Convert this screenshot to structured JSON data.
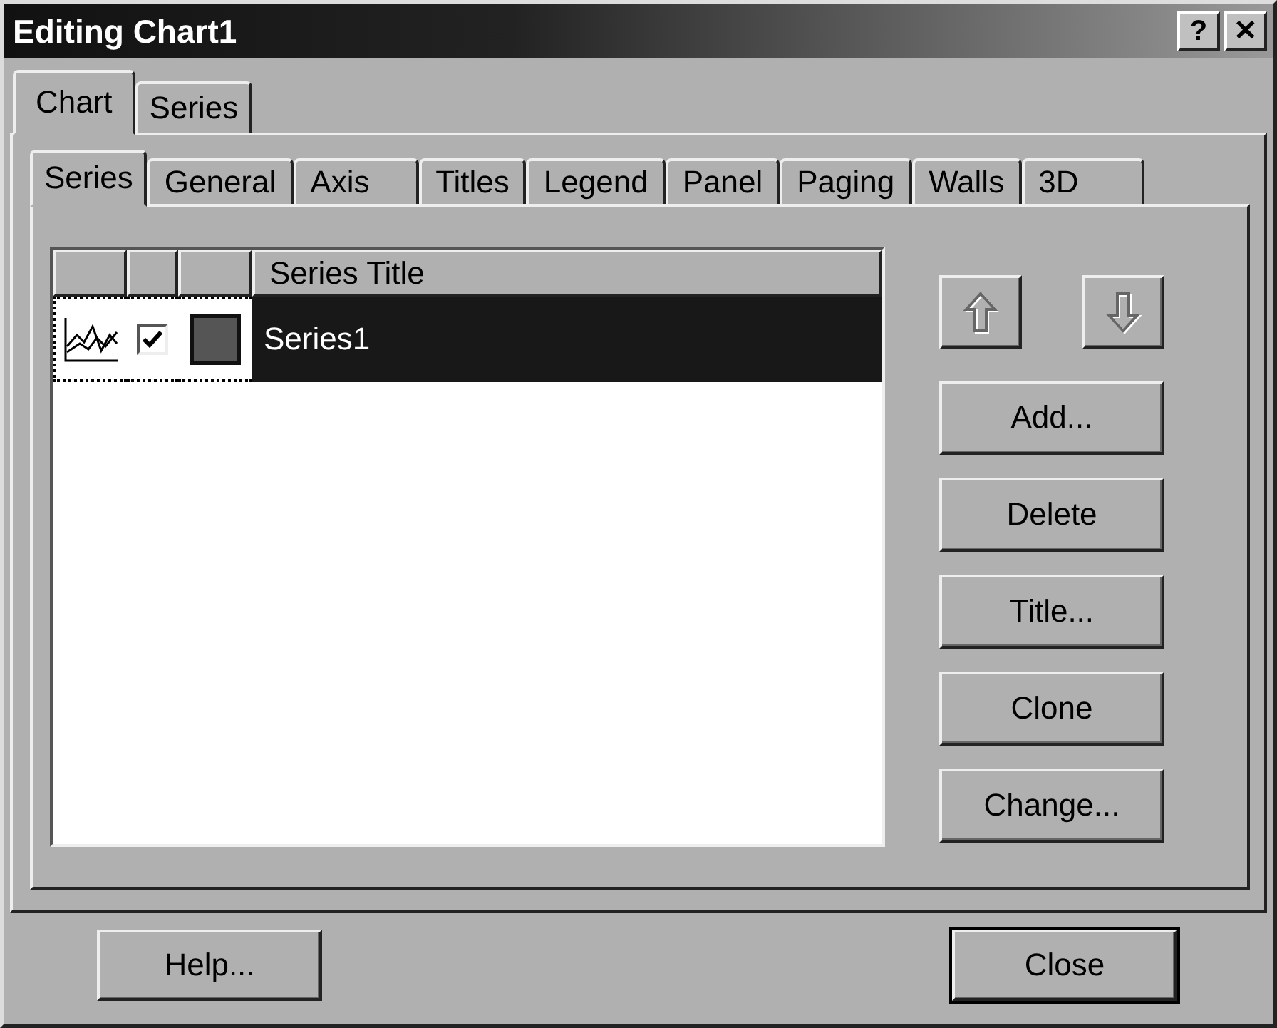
{
  "window": {
    "title": "Editing Chart1",
    "title_buttons": [
      "?",
      "✕"
    ]
  },
  "outer_tabs": [
    {
      "label": "Chart",
      "selected": true
    },
    {
      "label": "Series",
      "selected": false
    }
  ],
  "inner_tabs": [
    {
      "label": "Series",
      "selected": true
    },
    {
      "label": "General",
      "selected": false
    },
    {
      "label": "Axis",
      "selected": false
    },
    {
      "label": "Titles",
      "selected": false
    },
    {
      "label": "Legend",
      "selected": false
    },
    {
      "label": "Panel",
      "selected": false
    },
    {
      "label": "Paging",
      "selected": false
    },
    {
      "label": "Walls",
      "selected": false
    },
    {
      "label": "3D",
      "selected": false
    }
  ],
  "series_list": {
    "column_4": "Series Title",
    "rows": [
      {
        "title": "Series1",
        "selected": true,
        "checked": true,
        "color": "#555555"
      }
    ]
  },
  "side_buttons": [
    "Add...",
    "Delete",
    "Title...",
    "Clone",
    "Change..."
  ],
  "footer_buttons": [
    {
      "label": "Help...",
      "default": false
    },
    {
      "label": "Close",
      "default": true
    }
  ]
}
